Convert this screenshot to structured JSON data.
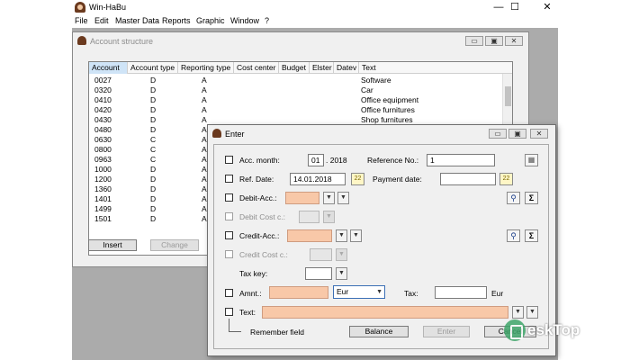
{
  "app": {
    "title": "Win-HaBu",
    "controls": {
      "minimize": "—",
      "maximize": "☐",
      "close": "✕"
    },
    "menu": [
      "File",
      "Edit",
      "Master Data",
      "Reports",
      "Graphic",
      "Window",
      "?"
    ]
  },
  "account_window": {
    "title": "Account structure",
    "columns": [
      "Account",
      "Account type",
      "Reporting type",
      "Cost center",
      "Budget",
      "Elster",
      "Datev",
      "Text"
    ],
    "rows": [
      {
        "account": "0027",
        "type": "D",
        "reporting": "A",
        "text": "Software"
      },
      {
        "account": "0320",
        "type": "D",
        "reporting": "A",
        "text": "Car"
      },
      {
        "account": "0410",
        "type": "D",
        "reporting": "A",
        "text": "Office equipment"
      },
      {
        "account": "0420",
        "type": "D",
        "reporting": "A",
        "text": "Office furnitures"
      },
      {
        "account": "0430",
        "type": "D",
        "reporting": "A",
        "text": "Shop furnitures"
      },
      {
        "account": "0480",
        "type": "D",
        "reporting": "A",
        "text": ""
      },
      {
        "account": "0630",
        "type": "C",
        "reporting": "A",
        "text": ""
      },
      {
        "account": "0800",
        "type": "C",
        "reporting": "A",
        "text": ""
      },
      {
        "account": "0963",
        "type": "C",
        "reporting": "A",
        "text": ""
      },
      {
        "account": "1000",
        "type": "D",
        "reporting": "A",
        "text": ""
      },
      {
        "account": "1200",
        "type": "D",
        "reporting": "A",
        "text": ""
      },
      {
        "account": "1360",
        "type": "D",
        "reporting": "A",
        "text": ""
      },
      {
        "account": "1401",
        "type": "D",
        "reporting": "A",
        "text": ""
      },
      {
        "account": "1499",
        "type": "D",
        "reporting": "A",
        "text": ""
      },
      {
        "account": "1501",
        "type": "D",
        "reporting": "A",
        "text": ""
      }
    ],
    "buttons": {
      "insert": "Insert",
      "change": "Change"
    }
  },
  "enter_dialog": {
    "title": "Enter",
    "acc_month_label": "Acc. month:",
    "acc_month_value": "01",
    "acc_year": ". 2018",
    "reference_label": "Reference No.:",
    "reference_value": "1",
    "ref_date_label": "Ref. Date:",
    "ref_date_value": "14.01.2018",
    "payment_date_label": "Payment date:",
    "payment_date_value": "",
    "debit_acc_label": "Debit-Acc.:",
    "debit_cost_label": "Debit Cost c.:",
    "credit_acc_label": "Credit-Acc.:",
    "credit_cost_label": "Credit Cost c.:",
    "tax_key_label": "Tax key:",
    "amount_label": "Amnt.:",
    "currency_value": "Eur",
    "tax_label": "Tax:",
    "tax_currency": "Eur",
    "text_label": "Text:",
    "remember_label": "Remember field",
    "buttons": {
      "balance": "Balance",
      "enter": "Enter",
      "cancel": "Cancel"
    },
    "glyphs": {
      "dropdown": "▼",
      "calendar": "22",
      "sigma": "Σ",
      "search": "⚲",
      "calc": "▦",
      "minimize": "▭",
      "maximize": "▣",
      "close": "✕"
    }
  },
  "watermark": {
    "text": "eskTop"
  },
  "colors": {
    "required_field": "#f8c8a8",
    "workspace": "#ababab",
    "selection": "#3b6fb5"
  }
}
